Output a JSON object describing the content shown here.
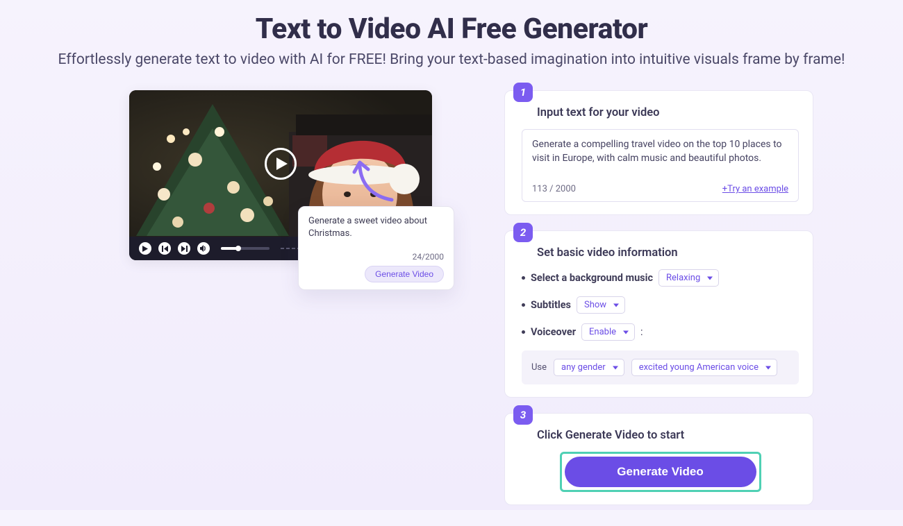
{
  "header": {
    "title": "Text to Video AI Free Generator",
    "subtitle": "Effortlessly generate text to video with AI for FREE! Bring your text-based imagination into intuitive visuals frame by frame!"
  },
  "preview": {
    "popover_text": "Generate a sweet video about Christmas.",
    "popover_count": "24/2000",
    "popover_button": "Generate Video"
  },
  "steps": {
    "s1": {
      "num": "1",
      "title": "Input text for your video",
      "text": "Generate a compelling travel video on the top 10 places to visit in Europe, with calm music and beautiful photos.",
      "count": "113 / 2000",
      "try": "+Try an example"
    },
    "s2": {
      "num": "2",
      "title": "Set basic video information",
      "bg_label": "Select a background music",
      "bg_value": "Relaxing",
      "sub_label": "Subtitles",
      "sub_value": "Show",
      "vo_label": "Voiceover",
      "vo_value": "Enable",
      "use_label": "Use",
      "gender": "any gender",
      "voice": "excited young American voice"
    },
    "s3": {
      "num": "3",
      "title": "Click Generate Video to start",
      "button": "Generate Video"
    }
  }
}
